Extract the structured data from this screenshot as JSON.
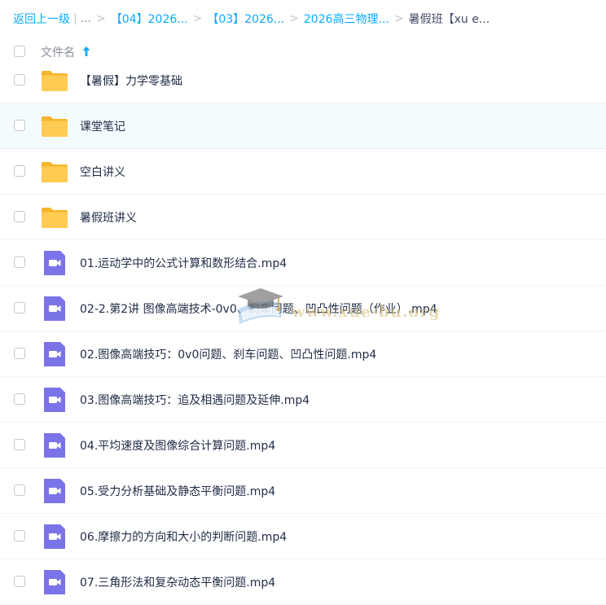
{
  "breadcrumb": {
    "back": "返回上一级",
    "pipe": "|",
    "ellipsis": "...",
    "items": [
      "【04】2026...",
      "【03】2026...",
      "2026高三物理...",
      "暑假班【xu e..."
    ],
    "sep": ">"
  },
  "header": {
    "name_label": "文件名",
    "sort": "ascending"
  },
  "files": [
    {
      "name": "【暑假】力学零基础",
      "type": "folder"
    },
    {
      "name": "课堂笔记",
      "type": "folder"
    },
    {
      "name": "空白讲义",
      "type": "folder"
    },
    {
      "name": "暑假班讲义",
      "type": "folder"
    },
    {
      "name": "01.运动学中的公式计算和数形结合.mp4",
      "type": "video"
    },
    {
      "name": "02-2.第2讲 图像高端技术-0v0、刹车问题、凹凸性问题（作业）.mp4",
      "type": "video"
    },
    {
      "name": "02.图像高端技巧：0v0问题、刹车问题、凹凸性问题.mp4",
      "type": "video"
    },
    {
      "name": "03.图像高端技巧：追及相遇问题及延伸.mp4",
      "type": "video"
    },
    {
      "name": "04.平均速度及图像综合计算问题.mp4",
      "type": "video"
    },
    {
      "name": "05.受力分析基础及静态平衡问题.mp4",
      "type": "video"
    },
    {
      "name": "06.摩擦力的方向和大小的判断问题.mp4",
      "type": "video"
    },
    {
      "name": "07.三角形法和复杂动态平衡问题.mp4",
      "type": "video"
    }
  ],
  "watermark": {
    "text": "www.xue-bu.org"
  },
  "colors": {
    "link": "#09aaff",
    "folder": "#ffc94d",
    "video": "#7b74e8",
    "hover_row": "#f4fbff"
  },
  "icons": {
    "folder": "folder-icon",
    "video": "video-file-icon",
    "sort": "arrow-up-icon"
  }
}
